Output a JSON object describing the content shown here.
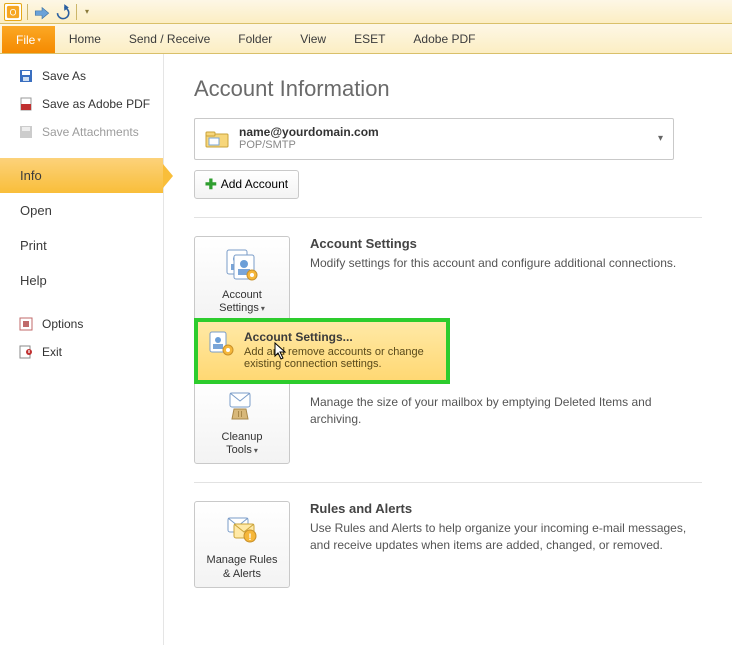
{
  "titlebar": {
    "app": "Outlook"
  },
  "tabs": {
    "file": "File",
    "home": "Home",
    "send_receive": "Send / Receive",
    "folder": "Folder",
    "view": "View",
    "eset": "ESET",
    "adobe_pdf": "Adobe PDF"
  },
  "sidebar": {
    "save_as": "Save As",
    "save_as_adobe_pdf": "Save as Adobe PDF",
    "save_attachments": "Save Attachments",
    "info": "Info",
    "open": "Open",
    "print": "Print",
    "help": "Help",
    "options": "Options",
    "exit": "Exit"
  },
  "content": {
    "title": "Account Information",
    "account": {
      "email": "name@yourdomain.com",
      "protocol": "POP/SMTP"
    },
    "add_account": "Add Account",
    "settings": {
      "button_line1": "Account",
      "button_line2": "Settings",
      "title": "Account Settings",
      "desc": "Modify settings for this account and configure additional connections.",
      "dropdown": {
        "title": "Account Settings...",
        "desc": "Add and remove accounts or change existing connection settings."
      }
    },
    "cleanup": {
      "button_line1": "Cleanup",
      "button_line2": "Tools",
      "desc": "Manage the size of your mailbox by emptying Deleted Items and archiving."
    },
    "rules": {
      "button_line1": "Manage Rules",
      "button_line2": "& Alerts",
      "title": "Rules and Alerts",
      "desc": "Use Rules and Alerts to help organize your incoming e-mail messages, and receive updates when items are added, changed, or removed."
    }
  }
}
